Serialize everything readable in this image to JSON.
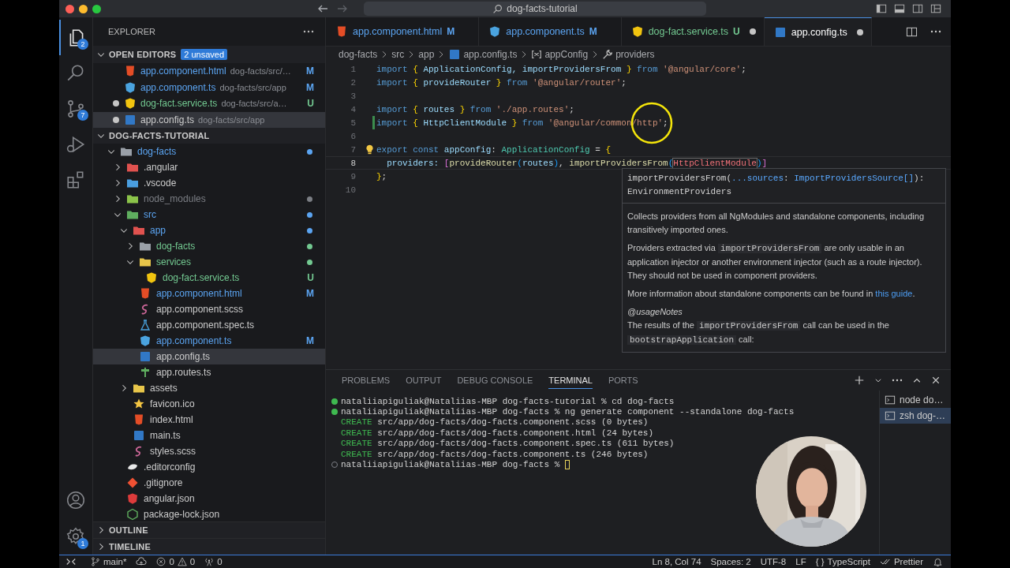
{
  "title_bar": {
    "search": "dog-facts-tutorial"
  },
  "activity_bar": {
    "items": [
      {
        "kind": "files",
        "badge": "2",
        "selected": true
      },
      {
        "kind": "search",
        "selected": false
      },
      {
        "kind": "source-control",
        "badge": "7",
        "selected": false
      },
      {
        "kind": "run-debug",
        "selected": false
      },
      {
        "kind": "extensions",
        "selected": false
      }
    ],
    "bottom": [
      {
        "kind": "account"
      },
      {
        "kind": "settings",
        "badge": "1"
      }
    ]
  },
  "sidebar": {
    "title": "EXPLORER",
    "open_editors": {
      "title": "OPEN EDITORS",
      "expanded": true,
      "badge": "2 unsaved",
      "items": [
        {
          "name": "app.component.html",
          "path": "dog-facts/src/…",
          "kind": "html",
          "color": "#5ba4f1",
          "status": "M",
          "dirty": false,
          "selected": false
        },
        {
          "name": "app.component.ts",
          "path": "dog-facts/src/app",
          "kind": "ng-component",
          "color": "#5ba4f1",
          "status": "M",
          "dirty": false,
          "selected": false
        },
        {
          "name": "dog-fact.service.ts",
          "path": "dog-facts/src/a…",
          "kind": "ng-service",
          "color": "#73c991",
          "status": "U",
          "dirty": true,
          "selected": false
        },
        {
          "name": "app.config.ts",
          "path": "dog-facts/src/app",
          "kind": "ts",
          "dirty": true,
          "selected": true
        }
      ]
    },
    "workspace": {
      "title": "DOG-FACTS-TUTORIAL",
      "expanded": true,
      "tree": [
        {
          "name": "dog-facts",
          "kind": "folder",
          "color": "#5ba4f1",
          "expanded": true,
          "selected": false,
          "children": [
            {
              "name": ".angular",
              "kind": "folder-angular",
              "expanded": false,
              "selected": false
            },
            {
              "name": ".vscode",
              "kind": "folder-vscode",
              "expanded": false,
              "selected": false
            },
            {
              "name": "node_modules",
              "kind": "folder-node",
              "color": "#7b7e84",
              "expanded": false,
              "selected": false
            },
            {
              "name": "src",
              "kind": "folder-src",
              "color": "#5ba4f1",
              "expanded": true,
              "selected": false,
              "children": [
                {
                  "name": "app",
                  "kind": "folder-app",
                  "color": "#5ba4f1",
                  "expanded": true,
                  "selected": false,
                  "children": [
                    {
                      "name": "dog-facts",
                      "kind": "folder",
                      "color": "#73c991",
                      "expanded": false,
                      "selected": false
                    },
                    {
                      "name": "services",
                      "kind": "folder-services",
                      "color": "#73c991",
                      "expanded": true,
                      "selected": false,
                      "children": [
                        {
                          "name": "dog-fact.service.ts",
                          "kind": "ng-service",
                          "color": "#73c991",
                          "status": "U",
                          "selected": false
                        }
                      ]
                    },
                    {
                      "name": "app.component.html",
                      "kind": "html",
                      "color": "#5ba4f1",
                      "status": "M",
                      "selected": false
                    },
                    {
                      "name": "app.component.scss",
                      "kind": "scss",
                      "selected": false
                    },
                    {
                      "name": "app.component.spec.ts",
                      "kind": "spec",
                      "selected": false
                    },
                    {
                      "name": "app.component.ts",
                      "kind": "ng-component",
                      "color": "#5ba4f1",
                      "status": "M",
                      "selected": false
                    },
                    {
                      "name": "app.config.ts",
                      "kind": "ts",
                      "selected": true
                    },
                    {
                      "name": "app.routes.ts",
                      "kind": "routes",
                      "selected": false
                    }
                  ]
                },
                {
                  "name": "assets",
                  "kind": "folder-assets",
                  "expanded": false,
                  "selected": false
                },
                {
                  "name": "favicon.ico",
                  "kind": "star",
                  "selected": false
                },
                {
                  "name": "index.html",
                  "kind": "html",
                  "selected": false
                },
                {
                  "name": "main.ts",
                  "kind": "ts",
                  "selected": false
                },
                {
                  "name": "styles.scss",
                  "kind": "scss",
                  "selected": false
                }
              ]
            },
            {
              "name": ".editorconfig",
              "kind": "editorconfig",
              "selected": false
            },
            {
              "name": ".gitignore",
              "kind": "git",
              "selected": false
            },
            {
              "name": "angular.json",
              "kind": "angular",
              "selected": false
            },
            {
              "name": "package-lock.json",
              "kind": "npm",
              "selected": false
            }
          ]
        }
      ]
    },
    "sections": [
      {
        "title": "OUTLINE",
        "expanded": false
      },
      {
        "title": "TIMELINE",
        "expanded": false
      }
    ]
  },
  "tabs": [
    {
      "label": "app.component.html",
      "kind": "html",
      "color": "#5ba4f1",
      "status": "M",
      "dirty": false,
      "selected": false
    },
    {
      "label": "app.component.ts",
      "kind": "ng-component",
      "color": "#5ba4f1",
      "status": "M",
      "dirty": false,
      "selected": false
    },
    {
      "label": "dog-fact.service.ts",
      "kind": "ng-service",
      "color": "#73c991",
      "status": "U",
      "dirty": true,
      "selected": false
    },
    {
      "label": "app.config.ts",
      "kind": "ts",
      "dirty": true,
      "selected": true
    }
  ],
  "breadcrumbs": [
    {
      "label": "dog-facts"
    },
    {
      "label": "src"
    },
    {
      "label": "app"
    },
    {
      "label": "app.config.ts",
      "kind": "ts"
    },
    {
      "label": "appConfig",
      "kind": "variable"
    },
    {
      "label": "providers",
      "kind": "wrench"
    }
  ],
  "code": {
    "lines": [
      {
        "number": "1",
        "added": false,
        "current": false,
        "tokens": [
          {
            "text": "import ",
            "kind": "kw"
          },
          {
            "text": "{ ",
            "kind": "br"
          },
          {
            "text": "ApplicationConfig, importProvidersFrom ",
            "kind": "id"
          },
          {
            "text": "} ",
            "kind": "br"
          },
          {
            "text": "from ",
            "kind": "kw"
          },
          {
            "text": "'@angular/core'",
            "kind": "str"
          },
          {
            "text": ";",
            "kind": "p"
          }
        ]
      },
      {
        "number": "2",
        "added": false,
        "current": false,
        "tokens": [
          {
            "text": "import ",
            "kind": "kw"
          },
          {
            "text": "{ ",
            "kind": "br"
          },
          {
            "text": "provideRouter ",
            "kind": "id"
          },
          {
            "text": "} ",
            "kind": "br"
          },
          {
            "text": "from ",
            "kind": "kw"
          },
          {
            "text": "'@angular/router'",
            "kind": "str"
          },
          {
            "text": ";",
            "kind": "p"
          }
        ]
      },
      {
        "number": "3",
        "added": false,
        "current": false
      },
      {
        "number": "4",
        "added": false,
        "current": false,
        "tokens": [
          {
            "text": "import ",
            "kind": "kw"
          },
          {
            "text": "{ ",
            "kind": "br"
          },
          {
            "text": "routes ",
            "kind": "id"
          },
          {
            "text": "} ",
            "kind": "br"
          },
          {
            "text": "from ",
            "kind": "kw"
          },
          {
            "text": "'./app.routes'",
            "kind": "str"
          },
          {
            "text": ";",
            "kind": "p"
          }
        ]
      },
      {
        "number": "5",
        "added": true,
        "current": false,
        "tokens": [
          {
            "text": "import ",
            "kind": "kw"
          },
          {
            "text": "{ ",
            "kind": "br"
          },
          {
            "text": "HttpClientModule ",
            "kind": "id"
          },
          {
            "text": "} ",
            "kind": "br"
          },
          {
            "text": "from ",
            "kind": "kw"
          },
          {
            "text": "'@angular/common/http'",
            "kind": "str"
          },
          {
            "text": ";",
            "kind": "p"
          }
        ]
      },
      {
        "number": "6",
        "added": false,
        "current": false
      },
      {
        "number": "7",
        "added": false,
        "current": false,
        "lightbulb": true,
        "tokens": [
          {
            "text": "export const ",
            "kind": "kw"
          },
          {
            "text": "appConfig",
            "kind": "id"
          },
          {
            "text": ": ",
            "kind": "p"
          },
          {
            "text": "ApplicationConfig",
            "kind": "type"
          },
          {
            "text": " = ",
            "kind": "p"
          },
          {
            "text": "{",
            "kind": "br"
          }
        ]
      },
      {
        "number": "8",
        "added": false,
        "current": true,
        "tokens": [
          {
            "text": "  providers: ",
            "kind": "id"
          },
          {
            "text": "[",
            "kind": "br2"
          },
          {
            "text": "provideRouter",
            "kind": "fn"
          },
          {
            "text": "(",
            "kind": "br3"
          },
          {
            "text": "routes",
            "kind": "id"
          },
          {
            "text": ")",
            "kind": "br3"
          },
          {
            "text": ", ",
            "kind": "p"
          },
          {
            "text": "importProvidersFrom",
            "kind": "fn"
          },
          {
            "text": "(",
            "kind": "br3"
          },
          {
            "text": "HttpClientModule",
            "kind": "hl"
          },
          {
            "text": ")",
            "kind": "br3"
          },
          {
            "text": "]",
            "kind": "br2"
          }
        ]
      },
      {
        "number": "9",
        "added": false,
        "current": false,
        "tokens": [
          {
            "text": "}",
            "kind": "br"
          },
          {
            "text": ";",
            "kind": "p"
          }
        ]
      },
      {
        "number": "10",
        "added": false,
        "current": false
      }
    ]
  },
  "hover": {
    "signature": [
      [
        {
          "text": "importProvidersFrom(",
          "kind": "p"
        },
        {
          "text": "...sources",
          "kind": "param"
        },
        {
          "text": ": ",
          "kind": "p"
        },
        {
          "text": "ImportProvidersSource[]",
          "kind": "ptype"
        },
        {
          "text": "):",
          "kind": "p"
        }
      ],
      [
        {
          "text": "EnvironmentProviders",
          "kind": "p"
        }
      ]
    ],
    "paragraphs": [
      {
        "kind": "text",
        "parts": [
          {
            "text": "Collects providers from all NgModules and standalone components, including transitively imported ones."
          }
        ]
      },
      {
        "kind": "text",
        "parts": [
          {
            "text": "Providers extracted via "
          },
          {
            "code": "importProvidersFrom"
          },
          {
            "text": " are only usable in an application injector or another environment injector (such as a route injector). They should not be used in component providers."
          }
        ]
      },
      {
        "kind": "text",
        "parts": [
          {
            "text": "More information about standalone components can be found in "
          },
          {
            "link": "this guide"
          },
          {
            "text": "."
          }
        ]
      },
      {
        "kind": "tag",
        "parts": [
          {
            "text": "@usageNotes"
          }
        ]
      },
      {
        "kind": "text",
        "parts": [
          {
            "text": "The results of the "
          },
          {
            "code": "importProvidersFrom"
          },
          {
            "text": " call can be used in the "
          },
          {
            "code": "bootstrapApplication"
          },
          {
            "text": " call:"
          }
        ]
      }
    ]
  },
  "panel": {
    "tabs": [
      {
        "label": "PROBLEMS",
        "selected": false
      },
      {
        "label": "OUTPUT",
        "selected": false
      },
      {
        "label": "DEBUG CONSOLE",
        "selected": false
      },
      {
        "label": "TERMINAL",
        "selected": true
      },
      {
        "label": "PORTS",
        "selected": false
      }
    ],
    "terminal": {
      "lines": [
        {
          "kind": "prompt",
          "succeeded": true,
          "cursor": false,
          "text": "nataliiapiguliak@Nataliias-MBP dog-facts-tutorial % cd dog-facts"
        },
        {
          "kind": "prompt",
          "succeeded": true,
          "cursor": false,
          "text": "nataliiapiguliak@Nataliias-MBP dog-facts % ng generate component --standalone dog-facts"
        },
        {
          "kind": "output",
          "label": "CREATE",
          "text": "src/app/dog-facts/dog-facts.component.scss (0 bytes)"
        },
        {
          "kind": "output",
          "label": "CREATE",
          "text": "src/app/dog-facts/dog-facts.component.html (24 bytes)"
        },
        {
          "kind": "output",
          "label": "CREATE",
          "text": "src/app/dog-facts/dog-facts.component.spec.ts (611 bytes)"
        },
        {
          "kind": "output",
          "label": "CREATE",
          "text": "src/app/dog-facts/dog-facts.component.ts (246 bytes)"
        },
        {
          "kind": "prompt",
          "succeeded": false,
          "cursor": true,
          "text": "nataliiapiguliak@Nataliias-MBP dog-facts %"
        }
      ]
    },
    "sessions": [
      {
        "label": "node do…",
        "selected": false
      },
      {
        "label": "zsh dog-…",
        "selected": true
      }
    ]
  },
  "status_bar": {
    "branch": "main*",
    "errors": "0",
    "warnings": "0",
    "ports": "0",
    "right": [
      {
        "text": "Ln 8, Col 74"
      },
      {
        "text": "Spaces: 2"
      },
      {
        "text": "UTF-8"
      },
      {
        "text": "LF"
      },
      {
        "prefix": "{ }",
        "text": "TypeScript"
      },
      {
        "kind": "check-all",
        "text": "Prettier"
      }
    ]
  }
}
